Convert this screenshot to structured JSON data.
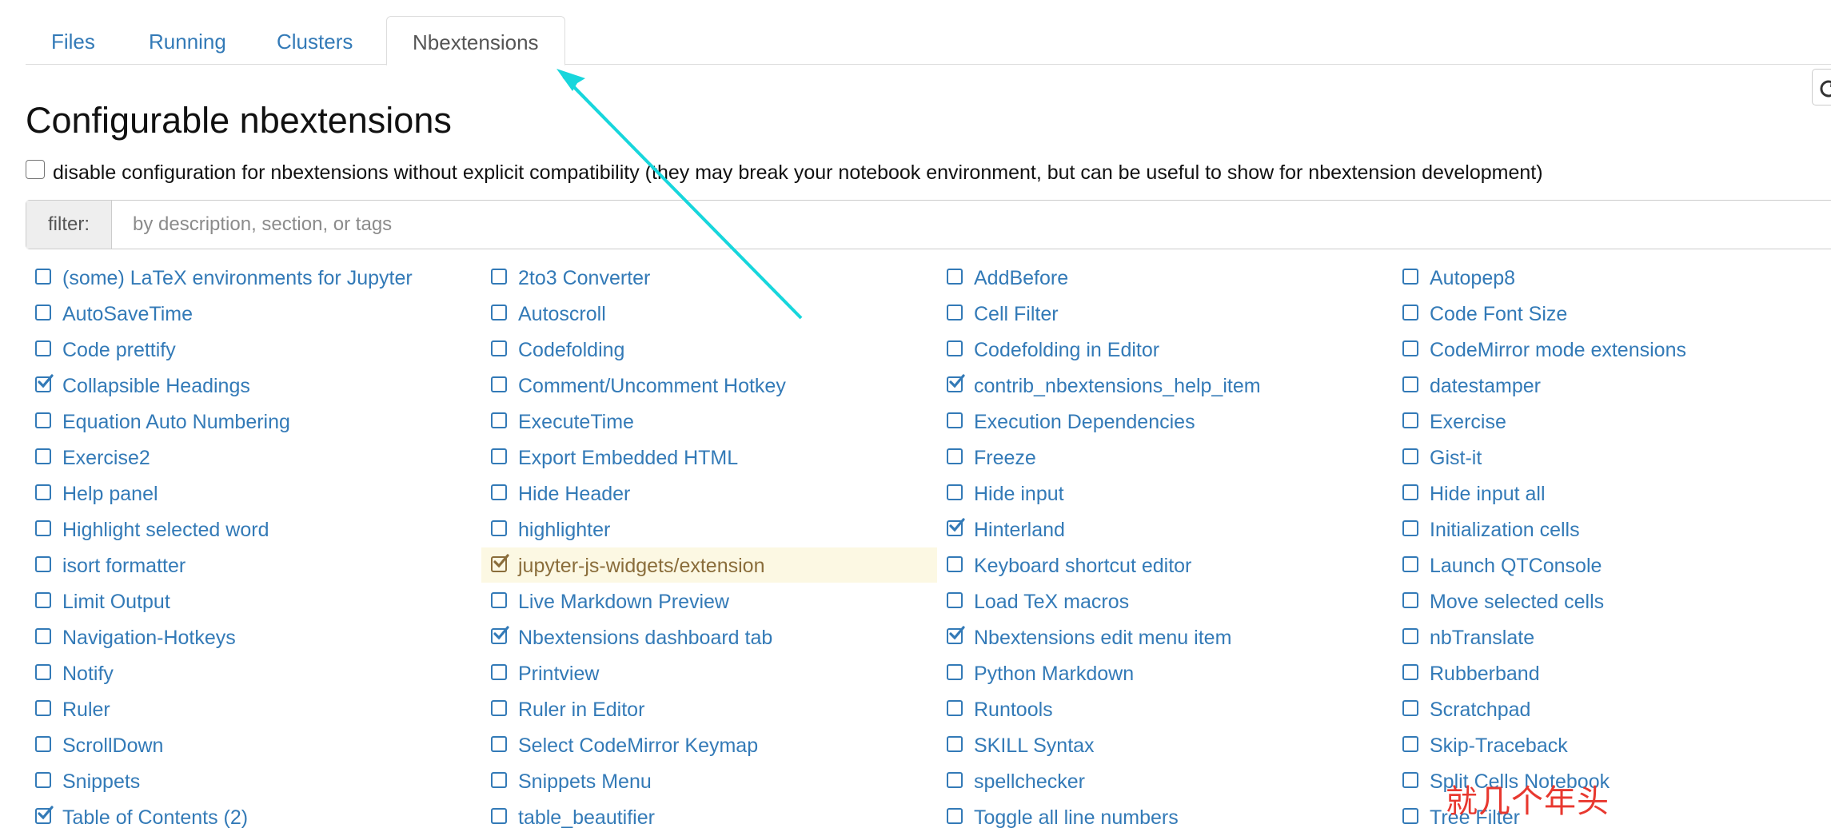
{
  "tabs": [
    {
      "label": "Files",
      "active": false
    },
    {
      "label": "Running",
      "active": false
    },
    {
      "label": "Clusters",
      "active": false
    },
    {
      "label": "Nbextensions",
      "active": true
    }
  ],
  "page_title": "Configurable nbextensions",
  "compat_option": {
    "label": "disable configuration for nbextensions without explicit compatibility (they may break your notebook environment, but can be useful to show for nbextension development)",
    "checked": false
  },
  "filter": {
    "label": "filter:",
    "placeholder": "by description, section, or tags"
  },
  "colors": {
    "link": "#337ab7",
    "highlight_bg": "#fcf8e3",
    "highlight_text": "#8a6d3b",
    "arrow": "#17d6dc",
    "watermark": "#e8382f"
  },
  "extensions": [
    {
      "label": "(some) LaTeX environments for Jupyter",
      "checked": false
    },
    {
      "label": "2to3 Converter",
      "checked": false
    },
    {
      "label": "AddBefore",
      "checked": false
    },
    {
      "label": "Autopep8",
      "checked": false
    },
    {
      "label": "AutoSaveTime",
      "checked": false
    },
    {
      "label": "Autoscroll",
      "checked": false
    },
    {
      "label": "Cell Filter",
      "checked": false
    },
    {
      "label": "Code Font Size",
      "checked": false
    },
    {
      "label": "Code prettify",
      "checked": false
    },
    {
      "label": "Codefolding",
      "checked": false
    },
    {
      "label": "Codefolding in Editor",
      "checked": false
    },
    {
      "label": "CodeMirror mode extensions",
      "checked": false
    },
    {
      "label": "Collapsible Headings",
      "checked": true
    },
    {
      "label": "Comment/Uncomment Hotkey",
      "checked": false
    },
    {
      "label": "contrib_nbextensions_help_item",
      "checked": true
    },
    {
      "label": "datestamper",
      "checked": false
    },
    {
      "label": "Equation Auto Numbering",
      "checked": false
    },
    {
      "label": "ExecuteTime",
      "checked": false
    },
    {
      "label": "Execution Dependencies",
      "checked": false
    },
    {
      "label": "Exercise",
      "checked": false
    },
    {
      "label": "Exercise2",
      "checked": false
    },
    {
      "label": "Export Embedded HTML",
      "checked": false
    },
    {
      "label": "Freeze",
      "checked": false
    },
    {
      "label": "Gist-it",
      "checked": false
    },
    {
      "label": "Help panel",
      "checked": false
    },
    {
      "label": "Hide Header",
      "checked": false
    },
    {
      "label": "Hide input",
      "checked": false
    },
    {
      "label": "Hide input all",
      "checked": false
    },
    {
      "label": "Highlight selected word",
      "checked": false
    },
    {
      "label": "highlighter",
      "checked": false
    },
    {
      "label": "Hinterland",
      "checked": true
    },
    {
      "label": "Initialization cells",
      "checked": false
    },
    {
      "label": "isort formatter",
      "checked": false
    },
    {
      "label": "jupyter-js-widgets/extension",
      "checked": true,
      "highlighted": true
    },
    {
      "label": "Keyboard shortcut editor",
      "checked": false
    },
    {
      "label": "Launch QTConsole",
      "checked": false
    },
    {
      "label": "Limit Output",
      "checked": false
    },
    {
      "label": "Live Markdown Preview",
      "checked": false
    },
    {
      "label": "Load TeX macros",
      "checked": false
    },
    {
      "label": "Move selected cells",
      "checked": false
    },
    {
      "label": "Navigation-Hotkeys",
      "checked": false
    },
    {
      "label": "Nbextensions dashboard tab",
      "checked": true
    },
    {
      "label": "Nbextensions edit menu item",
      "checked": true
    },
    {
      "label": "nbTranslate",
      "checked": false
    },
    {
      "label": "Notify",
      "checked": false
    },
    {
      "label": "Printview",
      "checked": false
    },
    {
      "label": "Python Markdown",
      "checked": false
    },
    {
      "label": "Rubberband",
      "checked": false
    },
    {
      "label": "Ruler",
      "checked": false
    },
    {
      "label": "Ruler in Editor",
      "checked": false
    },
    {
      "label": "Runtools",
      "checked": false
    },
    {
      "label": "Scratchpad",
      "checked": false
    },
    {
      "label": "ScrollDown",
      "checked": false
    },
    {
      "label": "Select CodeMirror Keymap",
      "checked": false
    },
    {
      "label": "SKILL Syntax",
      "checked": false
    },
    {
      "label": "Skip-Traceback",
      "checked": false
    },
    {
      "label": "Snippets",
      "checked": false
    },
    {
      "label": "Snippets Menu",
      "checked": false
    },
    {
      "label": "spellchecker",
      "checked": false
    },
    {
      "label": "Split Cells Notebook",
      "checked": false
    },
    {
      "label": "Table of Contents (2)",
      "checked": true
    },
    {
      "label": "table_beautifier",
      "checked": false
    },
    {
      "label": "Toggle all line numbers",
      "checked": false
    },
    {
      "label": "Tree Filter",
      "checked": false
    }
  ],
  "watermark_text": "就几个年头"
}
